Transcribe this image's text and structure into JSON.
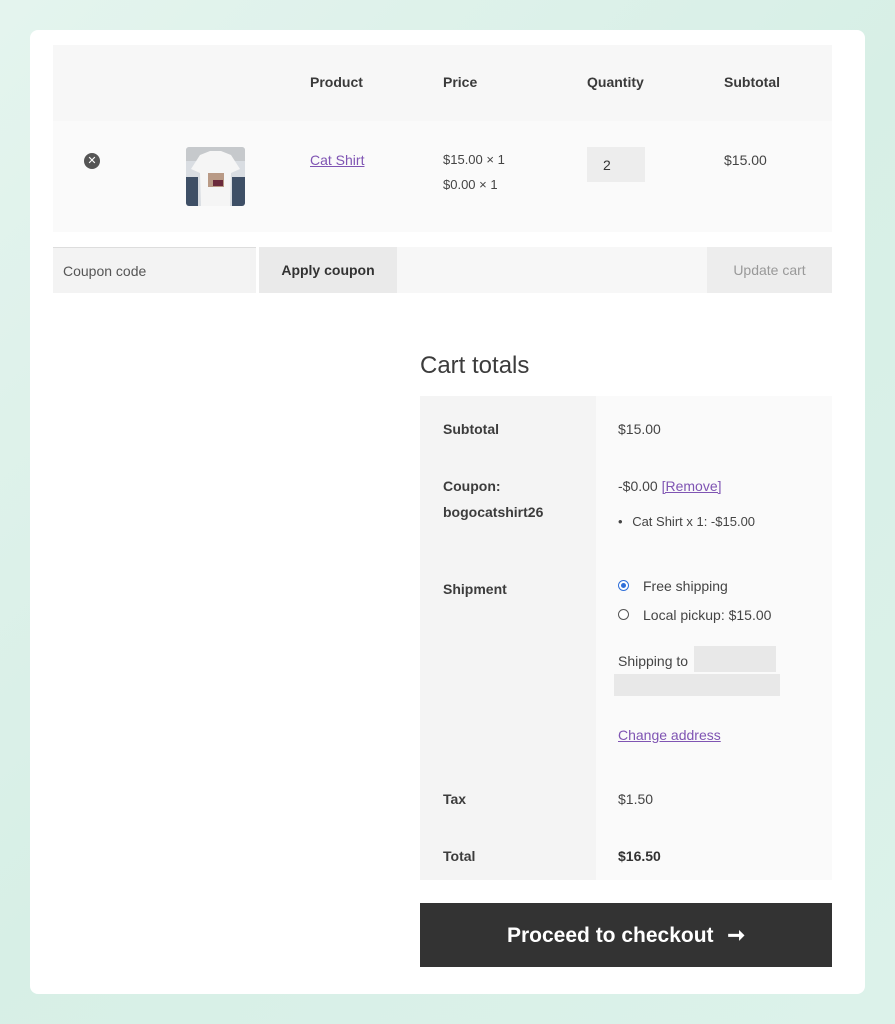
{
  "cart": {
    "headers": {
      "product": "Product",
      "price": "Price",
      "quantity": "Quantity",
      "subtotal": "Subtotal"
    },
    "items": [
      {
        "remove_icon": "x-circle",
        "name": "Cat Shirt",
        "price_lines": [
          "$15.00 × 1",
          "$0.00 × 1"
        ],
        "quantity": "2",
        "subtotal": "$15.00"
      }
    ],
    "coupon_placeholder": "Coupon code",
    "apply_label": "Apply coupon",
    "update_label": "Update cart"
  },
  "totals": {
    "title": "Cart totals",
    "subtotal_label": "Subtotal",
    "subtotal_value": "$15.00",
    "coupon_label": "Coupon:",
    "coupon_code": "bogocatshirt26",
    "coupon_discount": "-$0.00",
    "remove_link": "[Remove]",
    "coupon_detail": "Cat Shirt x 1: -$15.00",
    "shipment_label": "Shipment",
    "shipping_options": [
      {
        "label": "Free shipping",
        "selected": true
      },
      {
        "label": "Local pickup: $15.00",
        "selected": false
      }
    ],
    "shipping_to": "Shipping to",
    "change_address": "Change address",
    "tax_label": "Tax",
    "tax_value": "$1.50",
    "total_label": "Total",
    "total_value": "$16.50"
  },
  "checkout": {
    "label": "Proceed to checkout",
    "arrow": "➞"
  },
  "colors": {
    "accent": "#7f54b3",
    "button_dark": "#333333",
    "radio": "#2f6fd9"
  }
}
